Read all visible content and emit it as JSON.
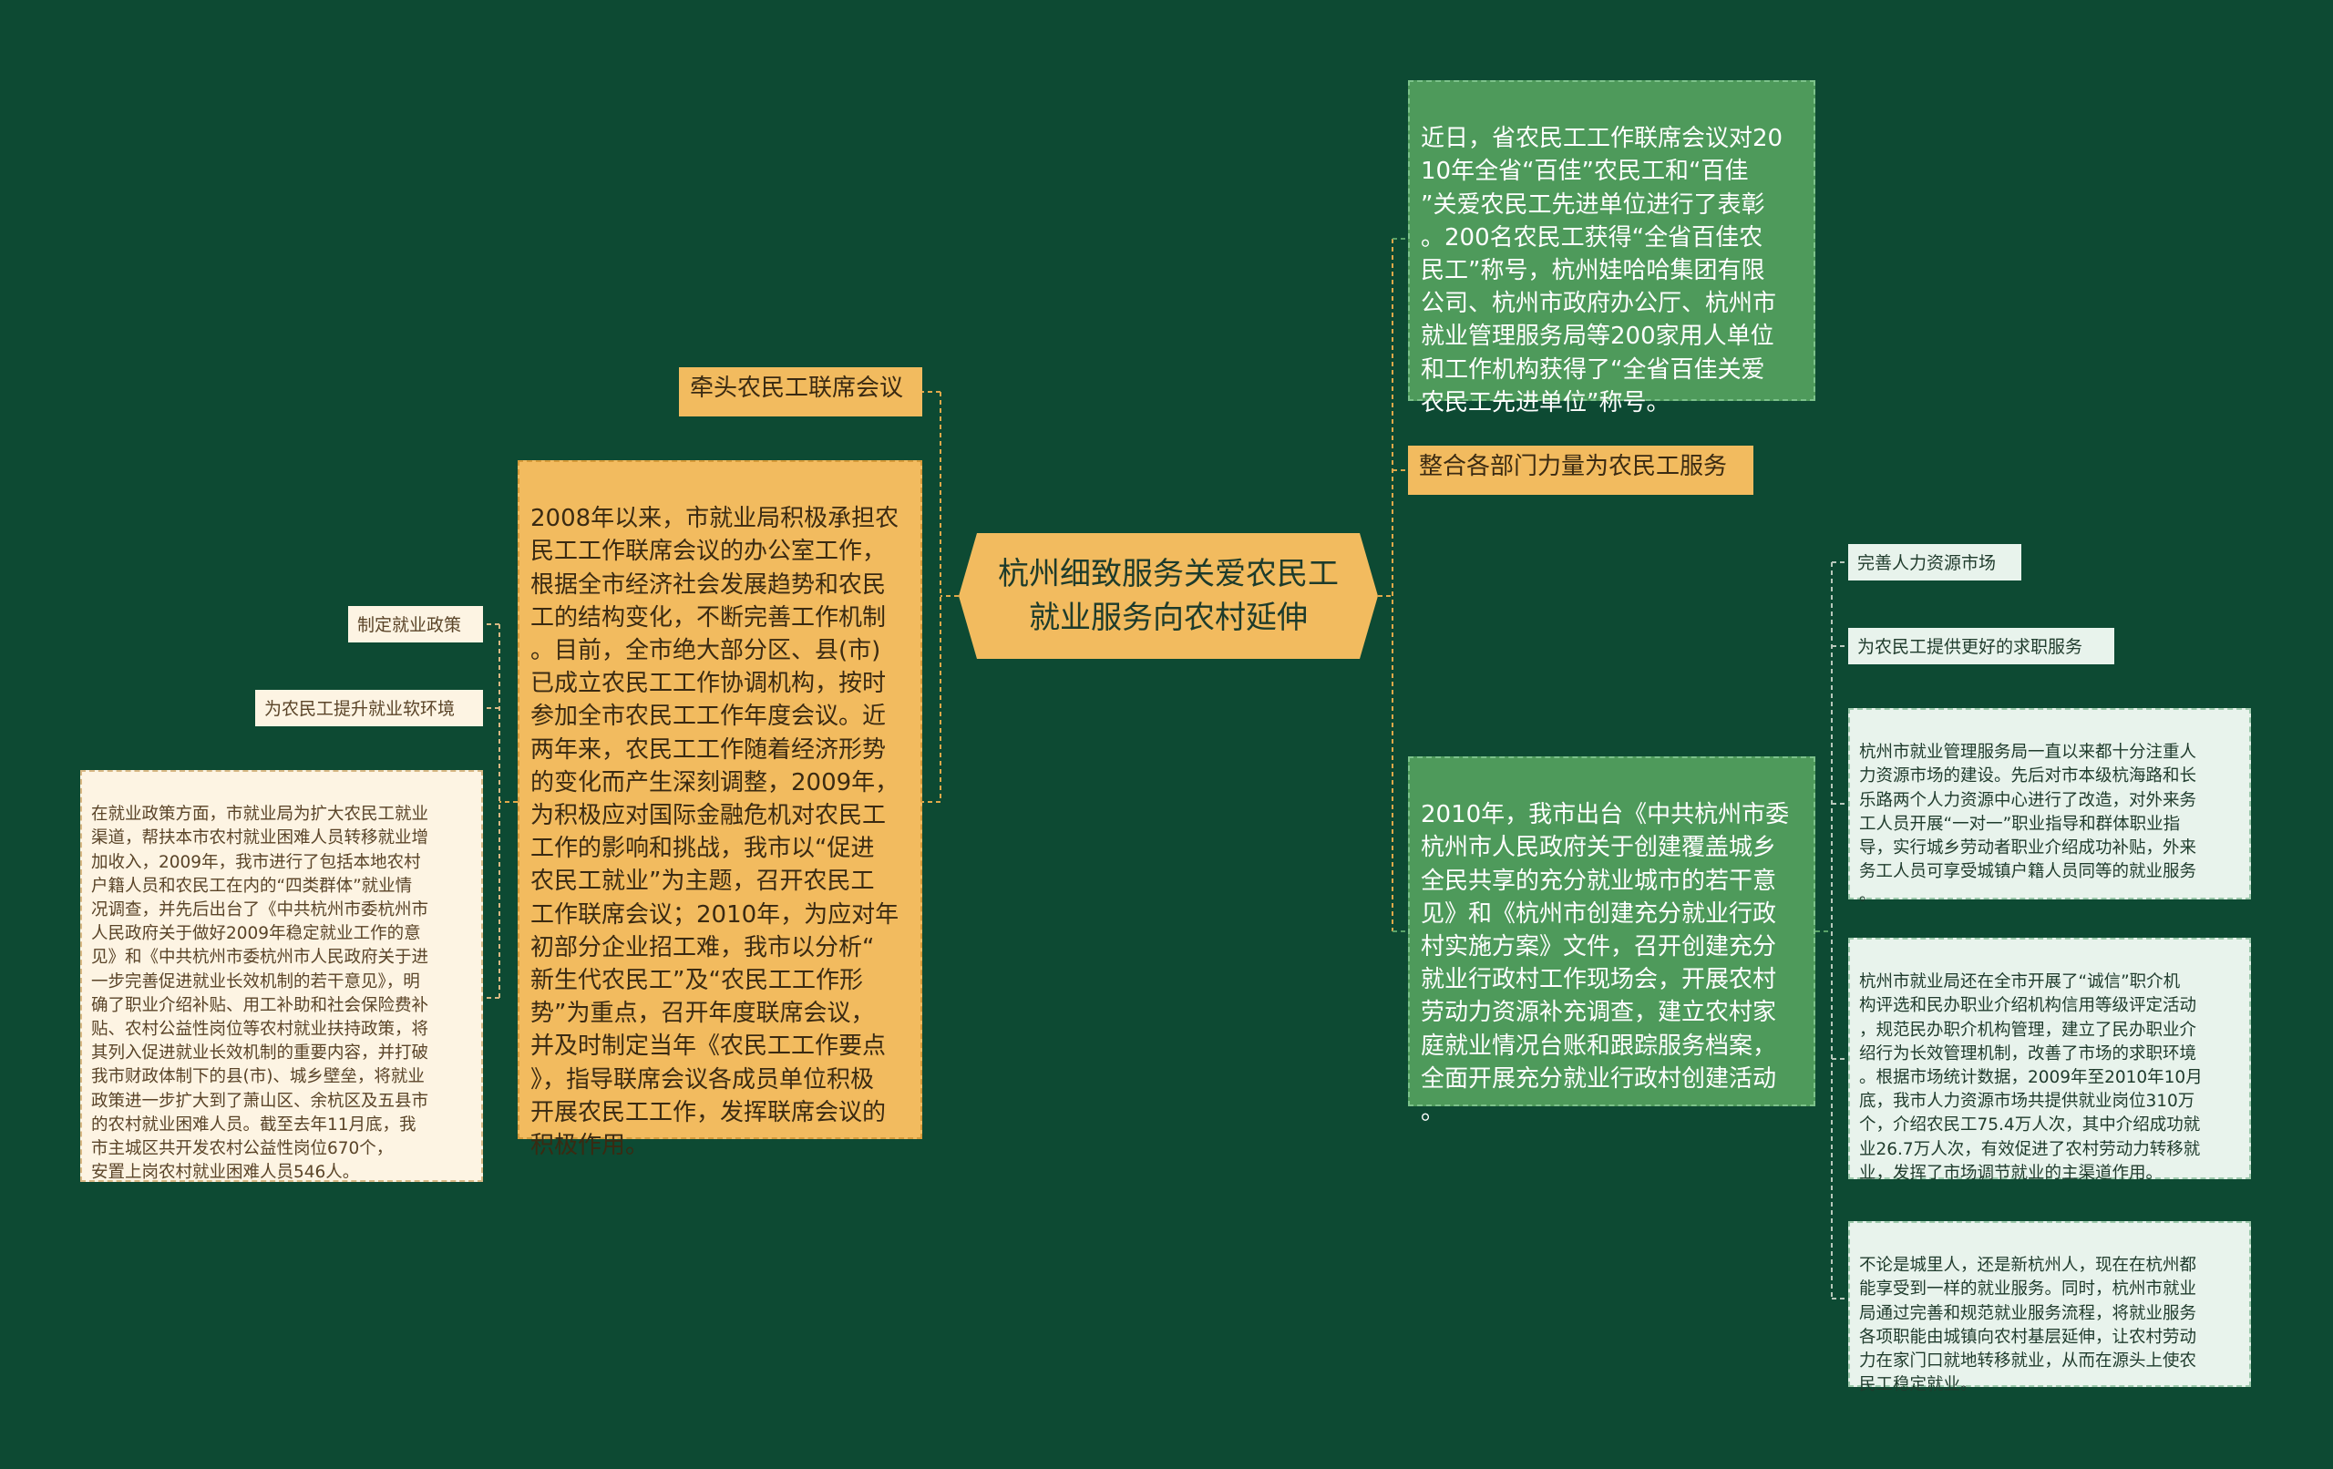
{
  "colors": {
    "background": "#0d4a33",
    "center_fill": "#f2bb5f",
    "orange_fill": "#f2bb5f",
    "green_fill": "#4e9a5b",
    "cream_fill": "#fdf4e3",
    "mint_fill": "#e8f3ec",
    "connector_orange": "#e0a84a",
    "connector_green": "#5aa36a",
    "connector_gray": "#b8c8bc"
  },
  "center": {
    "title": "杭州细致服务关爱农民工\n就业服务向农村延伸"
  },
  "left": {
    "lead_label": "牵头农民工联席会议",
    "lead_text": "2008年以来，市就业局积极承担农\n民工工作联席会议的办公室工作，\n根据全市经济社会发展趋势和农民\n工的结构变化，不断完善工作机制\n。目前，全市绝大部分区、县(市)\n已成立农民工工作协调机构，按时\n参加全市农民工工作年度会议。近\n两年来，农民工工作随着经济形势\n的变化而产生深刻调整，2009年，\n为积极应对国际金融危机对农民工\n工作的影响和挑战，我市以“促进\n农民工就业”为主题，召开农民工\n工作联席会议；2010年，为应对年\n初部分企业招工难，我市以分析“\n新生代农民工”及“农民工工作形\n势”为重点，召开年度联席会议，\n并及时制定当年《农民工工作要点\n》，指导联席会议各成员单位积极\n开展农民工工作，发挥联席会议的\n积极作用。",
    "policy_label": "制定就业政策",
    "soft_env_label": "为农民工提升就业软环境",
    "policy_text": "在就业政策方面，市就业局为扩大农民工就业\n渠道，帮扶本市农村就业困难人员转移就业增\n加收入，2009年，我市进行了包括本地农村\n户籍人员和农民工在内的“四类群体”就业情\n况调查，并先后出台了《中共杭州市委杭州市\n人民政府关于做好2009年稳定就业工作的意\n见》和《中共杭州市委杭州市人民政府关于进\n一步完善促进就业长效机制的若干意见》，明\n确了职业介绍补贴、用工补助和社会保险费补\n贴、农村公益性岗位等农村就业扶持政策，将\n其列入促进就业长效机制的重要内容，并打破\n我市财政体制下的县(市)、城乡壁垒，将就业\n政策进一步扩大到了萧山区、余杭区及五县市\n的农村就业困难人员。截至去年11月底，我\n市主城区共开发农村公益性岗位670个，\n安置上岗农村就业困难人员546人。"
  },
  "right": {
    "award_text": "近日，省农民工工作联席会议对20\n10年全省“百佳”农民工和“百佳\n”关爱农民工先进单位进行了表彰\n。200名农民工获得“全省百佳农\n民工”称号，杭州娃哈哈集团有限\n公司、杭州市政府办公厅、杭州市\n就业管理服务局等200家用人单位\n和工作机构获得了“全省百佳关爱\n农民工先进单位”称号。",
    "integrate_label": "整合各部门力量为农民工服务",
    "doc_text": "2010年，我市出台《中共杭州市委\n杭州市人民政府关于创建覆盖城乡\n全民共享的充分就业城市的若干意\n见》和《杭州市创建充分就业行政\n村实施方案》文件，召开创建充分\n就业行政村工作现场会，开展农村\n劳动力资源补充调查，建立农村家\n庭就业情况台账和跟踪服务档案，\n全面开展充分就业行政村创建活动\n。",
    "market_label": "完善人力资源市场",
    "service_label": "为农民工提供更好的求职服务",
    "market_text": "杭州市就业管理服务局一直以来都十分注重人\n力资源市场的建设。先后对市本级杭海路和长\n乐路两个人力资源中心进行了改造，对外来务\n工人员开展“一对一”职业指导和群体职业指\n导，实行城乡劳动者职业介绍成功补贴，外来\n务工人员可享受城镇户籍人员同等的就业服务\n。",
    "credit_text": "杭州市就业局还在全市开展了“诚信”职介机\n构评选和民办职业介绍机构信用等级评定活动\n，规范民办职介机构管理，建立了民办职业介\n绍行为长效管理机制，改善了市场的求职环境\n。根据市场统计数据，2009年至2010年10月\n底，我市人力资源市场共提供就业岗位310万\n个，介绍农民工75.4万人次，其中介绍成功就\n业26.7万人次，有效促进了农村劳动力转移就\n业，发挥了市场调节就业的主渠道作用。",
    "equal_text": "不论是城里人，还是新杭州人，现在在杭州都\n能享受到一样的就业服务。同时，杭州市就业\n局通过完善和规范就业服务流程，将就业服务\n各项职能由城镇向农村基层延伸，让农村劳动\n力在家门口就地转移就业，从而在源头上使农\n民工稳定就业。"
  }
}
